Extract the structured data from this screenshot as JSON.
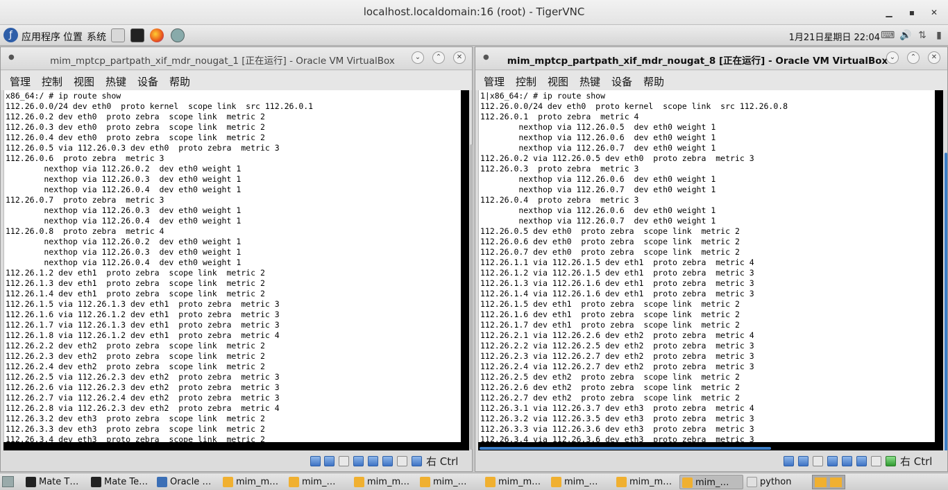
{
  "vnc": {
    "title": "localhost.localdomain:16 (root) - TigerVNC"
  },
  "top_panel": {
    "menus": [
      "应用程序",
      "位置",
      "系统"
    ],
    "clock": "1月21日星期日 22:04"
  },
  "left_vm": {
    "title": "mim_mptcp_partpath_xif_mdr_nougat_1 [正在运行] - Oracle VM VirtualBox",
    "menus": [
      "管理",
      "控制",
      "视图",
      "热键",
      "设备",
      "帮助"
    ],
    "host_key": "右 Ctrl",
    "terminal": "x86_64:/ # ip route show\n112.26.0.0/24 dev eth0  proto kernel  scope link  src 112.26.0.1\n112.26.0.2 dev eth0  proto zebra  scope link  metric 2\n112.26.0.3 dev eth0  proto zebra  scope link  metric 2\n112.26.0.4 dev eth0  proto zebra  scope link  metric 2\n112.26.0.5 via 112.26.0.3 dev eth0  proto zebra  metric 3\n112.26.0.6  proto zebra  metric 3\n        nexthop via 112.26.0.2  dev eth0 weight 1\n        nexthop via 112.26.0.3  dev eth0 weight 1\n        nexthop via 112.26.0.4  dev eth0 weight 1\n112.26.0.7  proto zebra  metric 3\n        nexthop via 112.26.0.3  dev eth0 weight 1\n        nexthop via 112.26.0.4  dev eth0 weight 1\n112.26.0.8  proto zebra  metric 4\n        nexthop via 112.26.0.2  dev eth0 weight 1\n        nexthop via 112.26.0.3  dev eth0 weight 1\n        nexthop via 112.26.0.4  dev eth0 weight 1\n112.26.1.2 dev eth1  proto zebra  scope link  metric 2\n112.26.1.3 dev eth1  proto zebra  scope link  metric 2\n112.26.1.4 dev eth1  proto zebra  scope link  metric 2\n112.26.1.5 via 112.26.1.3 dev eth1  proto zebra  metric 3\n112.26.1.6 via 112.26.1.2 dev eth1  proto zebra  metric 3\n112.26.1.7 via 112.26.1.3 dev eth1  proto zebra  metric 3\n112.26.1.8 via 112.26.1.2 dev eth1  proto zebra  metric 4\n112.26.2.2 dev eth2  proto zebra  scope link  metric 2\n112.26.2.3 dev eth2  proto zebra  scope link  metric 2\n112.26.2.4 dev eth2  proto zebra  scope link  metric 2\n112.26.2.5 via 112.26.2.3 dev eth2  proto zebra  metric 3\n112.26.2.6 via 112.26.2.3 dev eth2  proto zebra  metric 3\n112.26.2.7 via 112.26.2.4 dev eth2  proto zebra  metric 3\n112.26.2.8 via 112.26.2.3 dev eth2  proto zebra  metric 4\n112.26.3.2 dev eth3  proto zebra  scope link  metric 2\n112.26.3.3 dev eth3  proto zebra  scope link  metric 2\n112.26.3.4 dev eth3  proto zebra  scope link  metric 2"
  },
  "right_vm": {
    "title": "mim_mptcp_partpath_xif_mdr_nougat_8 [正在运行] - Oracle VM VirtualBox",
    "menus": [
      "管理",
      "控制",
      "视图",
      "热键",
      "设备",
      "帮助"
    ],
    "host_key": "右 Ctrl",
    "terminal": "1|x86_64:/ # ip route show\n112.26.0.0/24 dev eth0  proto kernel  scope link  src 112.26.0.8\n112.26.0.1  proto zebra  metric 4\n        nexthop via 112.26.0.5  dev eth0 weight 1\n        nexthop via 112.26.0.6  dev eth0 weight 1\n        nexthop via 112.26.0.7  dev eth0 weight 1\n112.26.0.2 via 112.26.0.5 dev eth0  proto zebra  metric 3\n112.26.0.3  proto zebra  metric 3\n        nexthop via 112.26.0.6  dev eth0 weight 1\n        nexthop via 112.26.0.7  dev eth0 weight 1\n112.26.0.4  proto zebra  metric 3\n        nexthop via 112.26.0.6  dev eth0 weight 1\n        nexthop via 112.26.0.7  dev eth0 weight 1\n112.26.0.5 dev eth0  proto zebra  scope link  metric 2\n112.26.0.6 dev eth0  proto zebra  scope link  metric 2\n112.26.0.7 dev eth0  proto zebra  scope link  metric 2\n112.26.1.1 via 112.26.1.5 dev eth1  proto zebra  metric 4\n112.26.1.2 via 112.26.1.5 dev eth1  proto zebra  metric 3\n112.26.1.3 via 112.26.1.6 dev eth1  proto zebra  metric 3\n112.26.1.4 via 112.26.1.6 dev eth1  proto zebra  metric 3\n112.26.1.5 dev eth1  proto zebra  scope link  metric 2\n112.26.1.6 dev eth1  proto zebra  scope link  metric 2\n112.26.1.7 dev eth1  proto zebra  scope link  metric 2\n112.26.2.1 via 112.26.2.6 dev eth2  proto zebra  metric 4\n112.26.2.2 via 112.26.2.5 dev eth2  proto zebra  metric 3\n112.26.2.3 via 112.26.2.7 dev eth2  proto zebra  metric 3\n112.26.2.4 via 112.26.2.7 dev eth2  proto zebra  metric 3\n112.26.2.5 dev eth2  proto zebra  scope link  metric 2\n112.26.2.6 dev eth2  proto zebra  scope link  metric 2\n112.26.2.7 dev eth2  proto zebra  scope link  metric 2\n112.26.3.1 via 112.26.3.7 dev eth3  proto zebra  metric 4\n112.26.3.2 via 112.26.3.5 dev eth3  proto zebra  metric 3\n112.26.3.3 via 112.26.3.6 dev eth3  proto zebra  metric 3\n112.26.3.4 via 112.26.3.6 dev eth3  proto zebra  metric 3"
  },
  "taskbar": {
    "items": [
      "Mate T…",
      "Mate Te…",
      "Oracle …",
      "mim_m…",
      "mim_…",
      "mim_m…",
      "mim_…",
      "mim_m…",
      "mim_…",
      "mim_m…",
      "mim_…",
      "python"
    ]
  }
}
